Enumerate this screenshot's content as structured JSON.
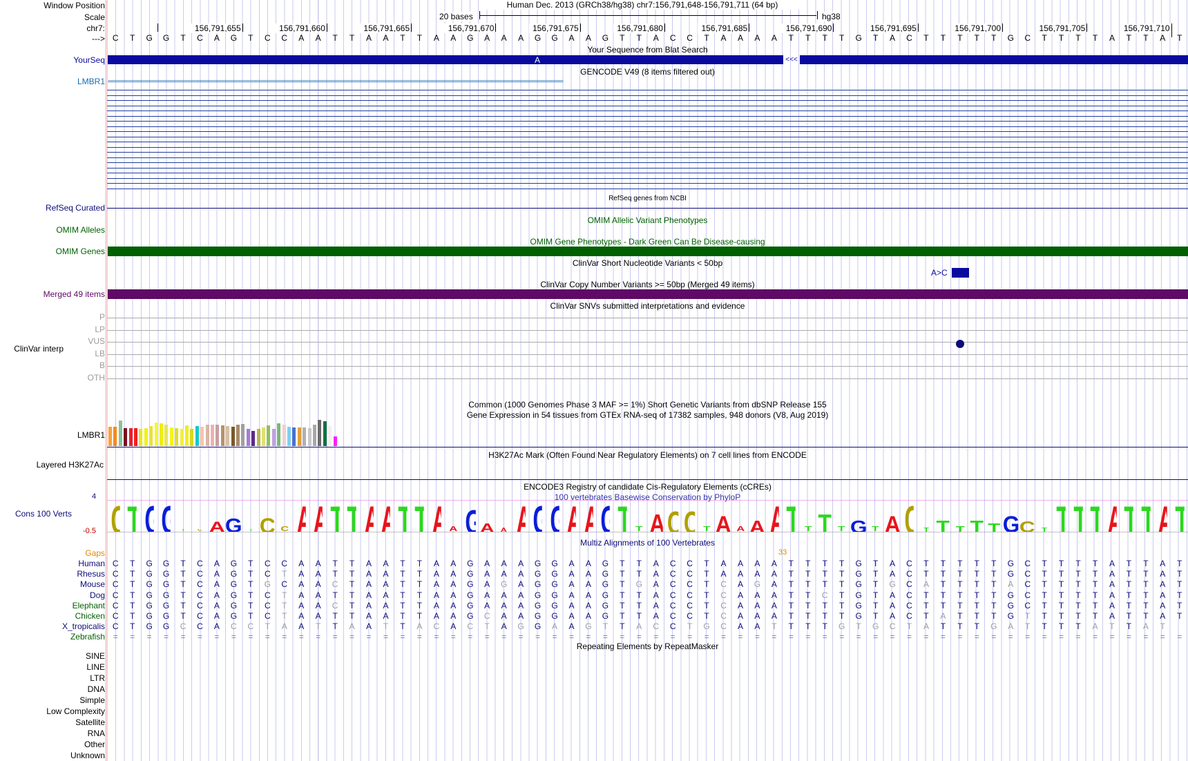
{
  "header": {
    "window_position_label": "Window Position",
    "scale_label": "Scale",
    "chrom_label": "chr7:",
    "arrow_label": "--->",
    "assembly_text": "Human Dec. 2013 (GRCh38/hg38)   chr7:156,791,648-156,791,711 (64 bp)",
    "scale_text": "20 bases",
    "db_text": "hg38"
  },
  "coordinates": [
    "156,791,655",
    "156,791,660",
    "156,791,665",
    "156,791,670",
    "156,791,675",
    "156,791,680",
    "156,791,685",
    "156,791,690",
    "156,791,695",
    "156,791,700",
    "156,791,705",
    "156,791,710"
  ],
  "sequence": "CTGGTCAGTCCAATTAATTAAGAAAGGAAGTTACCTAAAATTTTGTACTTTTTGCTTTTATTAT",
  "tracks": {
    "yourseq": {
      "label": "YourSeq",
      "title": "Your Sequence from Blat Search",
      "mark": "A",
      "color": "#0a0a9f"
    },
    "gencode": {
      "label": "LMBR1",
      "title": "GENCODE V49 (8 items filtered out)",
      "color": "#1a6cb3"
    },
    "refseq": {
      "label": "RefSeq Curated",
      "title": "RefSeq genes from NCBI",
      "color": "#0c0c78"
    },
    "omim_alleles": {
      "label": "OMIM Alleles",
      "title": "OMIM Allelic Variant Phenotypes",
      "color": "#006000"
    },
    "omim_genes": {
      "label": "OMIM Genes",
      "title": "OMIM Gene Phenotypes - Dark Green Can Be Disease-causing",
      "color": "#006000"
    },
    "clinvar_short": {
      "title": "ClinVar Short Nucleotide Variants < 50bp",
      "variant_label": "A>C"
    },
    "clinvar_cnv": {
      "label": "Merged 49 items",
      "title": "ClinVar Copy Number Variants >= 50bp (Merged 49 items)",
      "color": "#5e0a66"
    },
    "clinvar_interp": {
      "label": "ClinVar interp",
      "title": "ClinVar SNVs submitted interpretations and evidence",
      "levels": [
        "P",
        "LP",
        "VUS",
        "LB",
        "B",
        "OTH"
      ]
    },
    "dbsnp": {
      "title": "Common (1000 Genomes Phase 3 MAF >= 1%) Short Genetic Variants from dbSNP Release 155"
    },
    "gtex": {
      "label": "LMBR1",
      "title": "Gene Expression in 54 tissues from GTEx RNA-seq of 17382 samples, 948 donors (V8, Aug 2019)"
    },
    "h3k27ac": {
      "label": "Layered H3K27Ac",
      "title": "H3K27Ac Mark (Often Found Near Regulatory Elements) on 7 cell lines from ENCODE"
    },
    "ccre": {
      "title": "ENCODE3 Registry of candidate Cis-Regulatory Elements (cCREs)"
    },
    "cons": {
      "label": "Cons 100 Verts",
      "title": "100 vertebrates Basewise Conservation by PhyloP",
      "ymax": "4",
      "ymin": "-0.5"
    },
    "multiz": {
      "title": "Multiz Alignments of 100 Vertebrates",
      "gaps_label": "Gaps",
      "gap_count": "33"
    },
    "repeatmasker": {
      "title": "Repeating Elements by RepeatMasker",
      "classes": [
        "SINE",
        "LINE",
        "LTR",
        "DNA",
        "Simple",
        "Low Complexity",
        "Satellite",
        "RNA",
        "Other",
        "Unknown"
      ]
    }
  },
  "species": [
    {
      "name": "Human",
      "seq": "CTGGTCAGTCCAATTAATTAAGAAAGGAAGTTACCTAAAATTTTGTACTTTTTGCTTTTATTAT",
      "color": "#0c0c78"
    },
    {
      "name": "Rhesus",
      "seq": "CTGGTCAGTCTAATTAATTAAGAAAGGAAGTTACCTAAAATTTTGTACTTTTTGCTTTTATTAT",
      "color": "#0c0c78"
    },
    {
      "name": "Mouse",
      "seq": "CTGGTCAGTGCAACTAATTAAGAGAGGAAGTGACCTCAGATTTTGTGCATTTTACTTTTATTAT",
      "color": "#0c0c78"
    },
    {
      "name": "Dog",
      "seq": "CTGGTCAGTCTAATTAATTAAGAAAGGAAGTTACCTCAAATTCTGTACTTTTTGCTTTTATTAT",
      "color": "#0c0c78"
    },
    {
      "name": "Elephant",
      "seq": "CTGGTCAGTCTAACTAATTAAGAAAGGAAGTTACCTCAAATTTTGTACTTTTTGCTTTTATTAT",
      "color": "#006000"
    },
    {
      "name": "Chicken",
      "seq": "CTGGTCAGTCTAATTAATTAAGCAAGGAAGTTACCTCAAATTTTGTACTATTTGTTTTTATTAT",
      "color": "#006000"
    },
    {
      "name": "X_tropicalis",
      "seq": "CTGGCCACCTAATTAATTACACTAGGAAGTTACCTGCAATTTTGTGCTATTTGATTTTATTAT",
      "color": "#0c0c78"
    },
    {
      "name": "Zebrafish",
      "seq": "================================================================",
      "color": "#006000"
    }
  ],
  "colors": {
    "ruler_blue": "#c9c9ef",
    "clinvar_dot": "#0c0c78",
    "gap_orange": "#e08a00"
  }
}
